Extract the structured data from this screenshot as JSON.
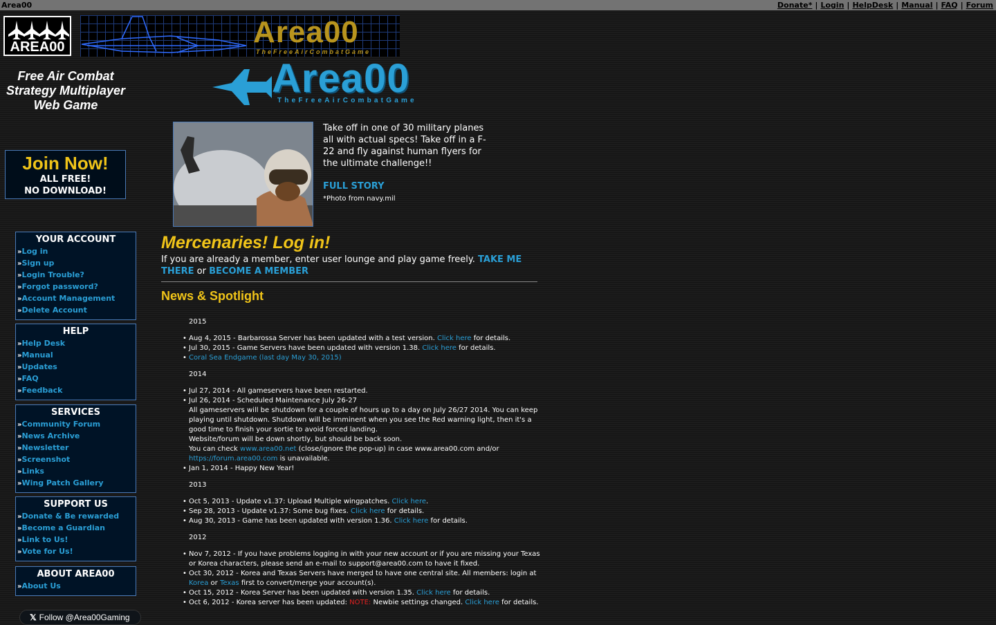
{
  "topbar": {
    "site_name": "Area00",
    "links": [
      "Donate*",
      "Login",
      "HelpDesk",
      "Manual",
      "FAQ",
      "Forum"
    ]
  },
  "logo": {
    "text": "AREA00"
  },
  "banner": {
    "title": "Area00",
    "subtitle": "TheFreeAirCombatGame"
  },
  "main_logo": {
    "title": "Area00",
    "subtitle": "TheFreeAirCombatGame"
  },
  "tagline": [
    "Free Air Combat",
    "Strategy Multiplayer",
    "Web Game"
  ],
  "join": {
    "title": "Join Now!",
    "line1": "ALL FREE!",
    "line2": "NO DOWNLOAD!"
  },
  "sidebar": {
    "account": {
      "title": "YOUR ACCOUNT",
      "items": [
        "Log in",
        "Sign up",
        "Login Trouble?",
        "Forgot password?",
        "Account Management",
        "Delete Account"
      ]
    },
    "help": {
      "title": "HELP",
      "items": [
        "Help Desk",
        "Manual",
        "Updates",
        "FAQ",
        "Feedback"
      ]
    },
    "services": {
      "title": "SERVICES",
      "items": [
        "Community Forum",
        "News Archive",
        "Newsletter",
        "Screenshot",
        "Links",
        "Wing Patch Gallery"
      ]
    },
    "support": {
      "title": "SUPPORT US",
      "items": [
        "Donate & Be rewarded",
        "Become a Guardian",
        "Link to Us!",
        "Vote for Us!"
      ]
    },
    "about": {
      "title": "ABOUT AREA00",
      "items": [
        "About Us"
      ]
    },
    "arrow": "»"
  },
  "follow": {
    "icon": "𝕏",
    "label": "Follow @Area00Gaming"
  },
  "story": {
    "text": "Take off in one of 30 military planes all with actual specs! Take off in a F-22 and fly against human flyers for the ultimate challenge!!",
    "link": "FULL STORY",
    "credit": "*Photo from navy.mil"
  },
  "merc": {
    "title": "Mercenaries! Log in!",
    "text": "If you are already a member, enter user lounge and play game freely.",
    "link1": "TAKE ME THERE",
    "or": "or",
    "link2": "BECOME A MEMBER"
  },
  "news_title": "News & Spotlight",
  "news": {
    "y2015": "2015",
    "n1": "Aug 4, 2015 - Barbarossa Server has been updated with a test version.",
    "n2": "Jul 30, 2015 - Game Servers have been updated with version 1.38.",
    "n3": "Coral Sea Endgame (last day May 30, 2015)",
    "y2014": "2014",
    "n4": "Jul 27, 2014 - All gameservers have been restarted.",
    "n5": "Jul 26, 2014 - Scheduled Maintenance July 26-27",
    "n5b": "All gameservers will be shutdown for a couple of hours up to a day on July 26/27 2014. You can keep playing until shutdown. Shutdown will be imminent when you see the Red warning light, then it's a good time to finish your sortie to avoid forced landing.",
    "n5c": "Website/forum will be down shortly, but should be back soon.",
    "n5d1": "You can check",
    "n5d_link1": "www.area00.net",
    "n5d2": "(close/ignore the pop-up) in case www.area00.com and/or",
    "n5d_link2": "https://forum.area00.com",
    "n5d3": "is unavailable.",
    "n6": "Jan 1, 2014 - Happy New Year!",
    "y2013": "2013",
    "n7": "Oct 5, 2013 - Update v1.37: Upload Multiple wingpatches.",
    "n8": "Sep 28, 2013 - Update v1.37: Some bug fixes.",
    "n9": "Aug 30, 2013 - Game has been updated with version 1.36.",
    "y2012": "2012",
    "n10": "Nov 7, 2012 - If you have problems logging in with your new account or if you are missing your Texas or Korea characters, please send an e-mail to support@area00.com to have it fixed.",
    "n11a": "Oct 30, 2012 - Korea and Texas Servers have merged to have one central site. All members: login at",
    "n11_korea": "Korea",
    "n11_or": "or",
    "n11_texas": "Texas",
    "n11b": "first to convert/merge your account(s).",
    "n12": "Oct 15, 2012 - Korea Server has been updated with version 1.35.",
    "n13a": "Oct 6, 2012 - Korea server has been updated:",
    "n13_note": "NOTE:",
    "n13b": "Newbie settings changed.",
    "click_here": "Click here",
    "for_details": "for details.",
    "period": "."
  }
}
